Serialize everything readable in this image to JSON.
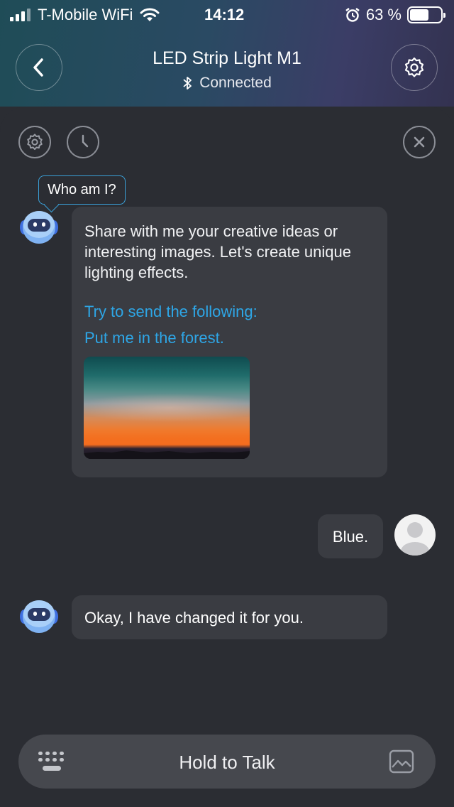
{
  "status_bar": {
    "carrier": "T-Mobile WiFi",
    "time": "14:12",
    "battery_percent": "63 %",
    "battery_level": 0.63
  },
  "header": {
    "title": "LED Strip Light M1",
    "connection": "Connected",
    "back_icon": "chevron-left-icon",
    "settings_icon": "gear-icon",
    "bluetooth_icon": "bluetooth-icon"
  },
  "toolbar": {
    "settings_icon": "gear-icon",
    "history_icon": "clock-icon",
    "close_icon": "close-icon"
  },
  "assistant": {
    "tooltip": "Who am I?"
  },
  "messages": [
    {
      "role": "bot",
      "text": "Share with me your creative ideas or interesting images. Let's create unique lighting effects.",
      "hint": "Try to send the following:",
      "sample": "Put me in the forest."
    },
    {
      "role": "user",
      "text": "Blue."
    },
    {
      "role": "bot",
      "text": "Okay, I have changed it for you."
    }
  ],
  "input": {
    "talk_label": "Hold to Talk",
    "keyboard_icon": "keyboard-icon",
    "image_icon": "image-icon"
  },
  "colors": {
    "header_start": "#1f4c57",
    "header_end": "#3b3d66",
    "background": "#2b2d33",
    "bubble": "#3a3c42",
    "accent": "#2ea6e6"
  }
}
